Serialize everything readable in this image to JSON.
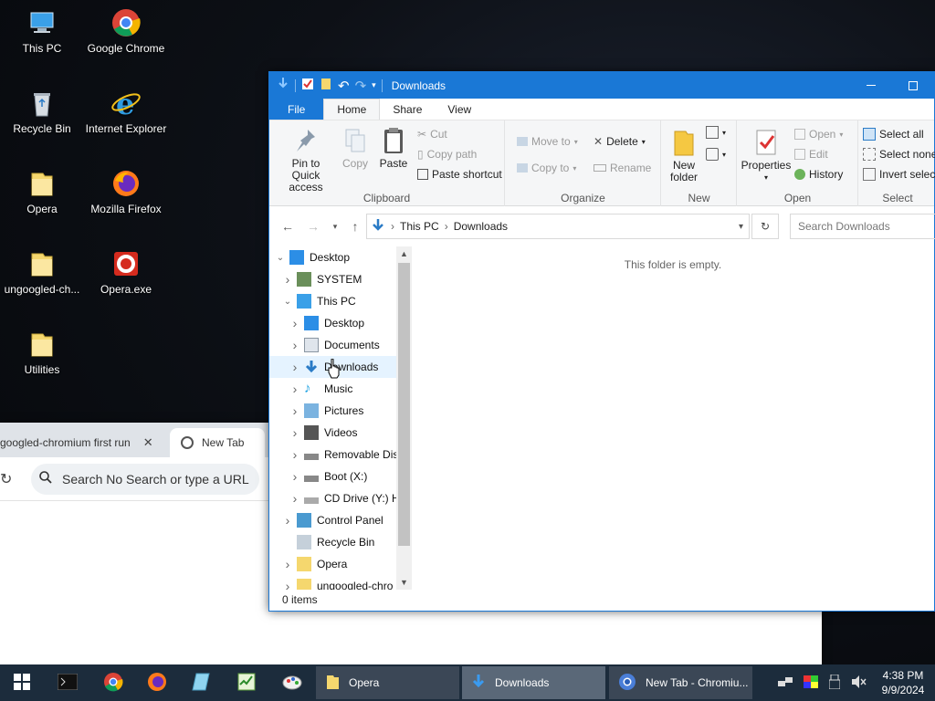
{
  "desktop": {
    "icons": [
      {
        "label": "This PC",
        "icon": "this-pc-icon"
      },
      {
        "label": "Google Chrome",
        "icon": "chrome-icon"
      },
      {
        "label": "Recycle Bin",
        "icon": "recycle-bin-icon"
      },
      {
        "label": "Internet Explorer",
        "icon": "ie-icon"
      },
      {
        "label": "Opera",
        "icon": "folder-icon"
      },
      {
        "label": "Mozilla Firefox",
        "icon": "firefox-icon"
      },
      {
        "label": "ungoogled-ch...",
        "icon": "folder-icon"
      },
      {
        "label": "Opera.exe",
        "icon": "opera-exe-icon"
      },
      {
        "label": "Utilities",
        "icon": "folder-icon"
      }
    ]
  },
  "browser": {
    "tabs": [
      {
        "label": "googled-chromium first run"
      },
      {
        "label": "New Tab"
      }
    ],
    "omnibox_placeholder": "Search No Search or type a URL"
  },
  "explorer": {
    "title": "Downloads",
    "ribbon_tabs": [
      "File",
      "Home",
      "Share",
      "View"
    ],
    "clipboard": {
      "pin": "Pin to Quick access",
      "copy": "Copy",
      "paste": "Paste",
      "cut": "Cut",
      "copy_path": "Copy path",
      "paste_shortcut": "Paste shortcut",
      "group": "Clipboard"
    },
    "organize": {
      "move_to": "Move to",
      "copy_to": "Copy to",
      "delete": "Delete",
      "rename": "Rename",
      "group": "Organize"
    },
    "new": {
      "new_folder_1": "New",
      "new_folder_2": "folder",
      "group": "New"
    },
    "open": {
      "properties": "Properties",
      "open": "Open",
      "edit": "Edit",
      "history": "History",
      "group": "Open"
    },
    "select": {
      "select_all": "Select all",
      "select_none": "Select none",
      "invert": "Invert selection",
      "group": "Select"
    },
    "address": {
      "crumb1": "This PC",
      "crumb2": "Downloads",
      "search_placeholder": "Search Downloads"
    },
    "tree": [
      {
        "label": "Desktop",
        "indent": 0,
        "chev": "v",
        "icon": "desktop-icon"
      },
      {
        "label": "SYSTEM",
        "indent": 1,
        "chev": ">",
        "icon": "user-icon"
      },
      {
        "label": "This PC",
        "indent": 1,
        "chev": "v",
        "icon": "this-pc-icon"
      },
      {
        "label": "Desktop",
        "indent": 2,
        "chev": ">",
        "icon": "desktop-icon"
      },
      {
        "label": "Documents",
        "indent": 2,
        "chev": ">",
        "icon": "documents-icon"
      },
      {
        "label": "Downloads",
        "indent": 2,
        "chev": ">",
        "icon": "downloads-icon"
      },
      {
        "label": "Music",
        "indent": 2,
        "chev": ">",
        "icon": "music-icon"
      },
      {
        "label": "Pictures",
        "indent": 2,
        "chev": ">",
        "icon": "pictures-icon"
      },
      {
        "label": "Videos",
        "indent": 2,
        "chev": ">",
        "icon": "videos-icon"
      },
      {
        "label": "Removable Dis",
        "indent": 2,
        "chev": ">",
        "icon": "drive-icon"
      },
      {
        "label": "Boot (X:)",
        "indent": 2,
        "chev": ">",
        "icon": "drive-icon"
      },
      {
        "label": "CD Drive (Y:) H",
        "indent": 2,
        "chev": ">",
        "icon": "cd-drive-icon"
      },
      {
        "label": "Control Panel",
        "indent": 1,
        "chev": ">",
        "icon": "control-panel-icon"
      },
      {
        "label": "Recycle Bin",
        "indent": 1,
        "chev": "",
        "icon": "recycle-bin-icon"
      },
      {
        "label": "Opera",
        "indent": 1,
        "chev": ">",
        "icon": "folder-icon"
      },
      {
        "label": "ungoogled-chro",
        "indent": 1,
        "chev": ">",
        "icon": "folder-icon"
      }
    ],
    "empty_message": "This folder is empty.",
    "status": "0 items"
  },
  "taskbar": {
    "tasks": [
      {
        "label": "Opera"
      },
      {
        "label": "Downloads"
      },
      {
        "label": "New Tab - Chromiu..."
      }
    ],
    "time": "4:38 PM",
    "date": "9/9/2024"
  }
}
